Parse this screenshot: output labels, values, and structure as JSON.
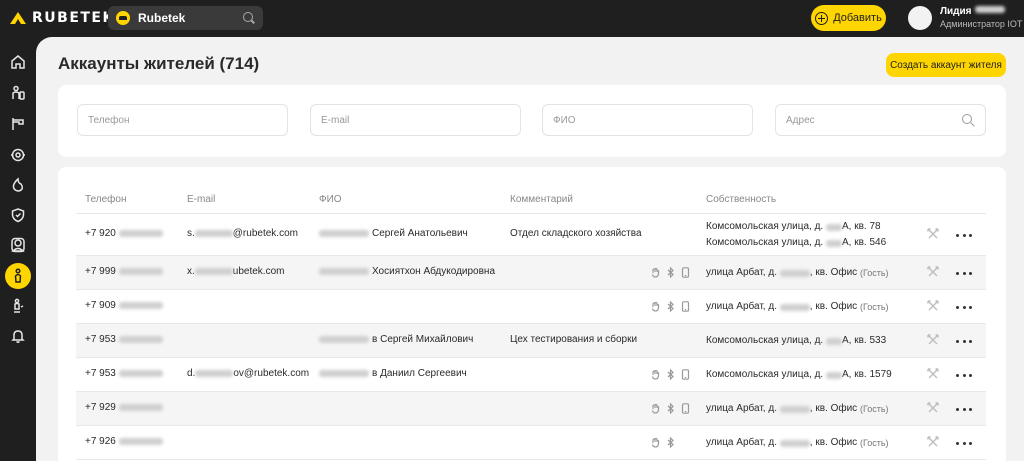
{
  "brand": {
    "name": "RUBETEK",
    "accent": "#ffd500"
  },
  "header": {
    "project": {
      "name": "Rubetek",
      "icon": "project-home-icon"
    },
    "add_label": "Добавить",
    "user": {
      "first_name": "Лидия",
      "role": "Администратор IOT"
    }
  },
  "sidebar": {
    "items": [
      {
        "name": "home",
        "icon": "home-icon"
      },
      {
        "name": "residents-devices",
        "icon": "person-icon"
      },
      {
        "name": "intercom",
        "icon": "intercom-icon"
      },
      {
        "name": "camera",
        "icon": "camera-icon"
      },
      {
        "name": "fire",
        "icon": "fire-icon"
      },
      {
        "name": "security",
        "icon": "shield-icon"
      },
      {
        "name": "staff",
        "icon": "badge-icon"
      },
      {
        "name": "residents",
        "icon": "resident-icon",
        "active": true
      },
      {
        "name": "bugs",
        "icon": "bug-icon"
      },
      {
        "name": "notifications",
        "icon": "bell-icon"
      }
    ]
  },
  "page": {
    "title": "Аккаунты жителей (714)",
    "create_label": "Создать аккаунт жителя"
  },
  "filters": {
    "phone": "Телефон",
    "email": "E-mail",
    "fio": "ФИО",
    "address": "Адрес"
  },
  "table": {
    "columns": {
      "phone": "Телефон",
      "email": "E-mail",
      "fio": "ФИО",
      "comment": "Комментарий",
      "property": "Собственность"
    },
    "rows": [
      {
        "phone": "+7 920",
        "email_a": "s.",
        "email_b": "@rubetek.com",
        "fio": "Сергей Анатольевич",
        "comment": "Отдел складского хозяйства",
        "devices": false,
        "property": [
          {
            "a": "Комсомольская улица, д.",
            "b": "А, кв. 78",
            "guest": ""
          },
          {
            "a": "Комсомольская улица, д.",
            "b": "А, кв. 546",
            "guest": ""
          }
        ]
      },
      {
        "phone": "+7 999",
        "email_a": "x.",
        "email_b": "ubetek.com",
        "fio": "Хосиятхон Абдукодировна",
        "comment": "",
        "devices": true,
        "property": [
          {
            "a": "улица Арбат, д.",
            "b": ", кв. Офис",
            "guest": "(Гость)"
          }
        ]
      },
      {
        "phone": "+7 909",
        "email_a": "",
        "email_b": "",
        "fio": "",
        "comment": "",
        "devices": true,
        "property": [
          {
            "a": "улица Арбат, д.",
            "b": ", кв. Офис",
            "guest": "(Гость)"
          }
        ]
      },
      {
        "phone": "+7 953",
        "email_a": "",
        "email_b": "",
        "fio": "в Сергей Михайлович",
        "comment": "Цех тестирования и сборки",
        "devices": false,
        "property": [
          {
            "a": "Комсомольская улица, д.",
            "b": "А, кв. 533",
            "guest": ""
          }
        ]
      },
      {
        "phone": "+7 953",
        "email_a": "d.",
        "email_b": "ov@rubetek.com",
        "fio": "в Даниил Сергеевич",
        "comment": "",
        "devices": true,
        "property": [
          {
            "a": "Комсомольская улица, д.",
            "b": "А, кв. 1579",
            "guest": ""
          }
        ]
      },
      {
        "phone": "+7 929",
        "email_a": "",
        "email_b": "",
        "fio": "",
        "comment": "",
        "devices": true,
        "property": [
          {
            "a": "улица Арбат, д.",
            "b": ", кв. Офис",
            "guest": "(Гость)"
          }
        ]
      },
      {
        "phone": "+7 926",
        "email_a": "",
        "email_b": "",
        "fio": "",
        "comment": "",
        "devices": true,
        "property": [
          {
            "a": "улица Арбат, д.",
            "b": ", кв. Офис",
            "guest": "(Гость)"
          }
        ]
      }
    ]
  }
}
